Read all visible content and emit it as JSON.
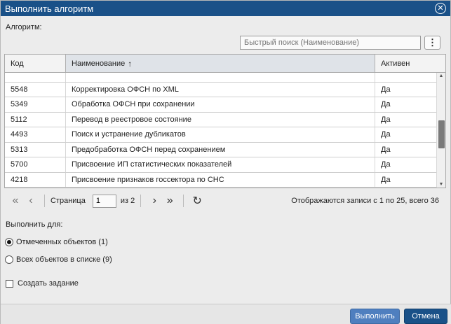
{
  "window": {
    "title": "Выполнить алгоритм"
  },
  "algorithm": {
    "label": "Алгоритм:",
    "search_placeholder": "Быстрый поиск (Наименование)",
    "menu_glyph": "⋮"
  },
  "grid": {
    "columns": {
      "code": "Код",
      "name": "Наименование",
      "active": "Активен"
    },
    "sort_arrow": "↑",
    "rows": [
      {
        "code": "",
        "name": "",
        "active": ""
      },
      {
        "code": "5548",
        "name": "Корректировка ОФСН по XML",
        "active": "Да"
      },
      {
        "code": "5349",
        "name": "Обработка ОФСН при сохранении",
        "active": "Да"
      },
      {
        "code": "5112",
        "name": "Перевод в реестровое состояние",
        "active": "Да"
      },
      {
        "code": "4493",
        "name": "Поиск и устранение дубликатов",
        "active": "Да"
      },
      {
        "code": "5313",
        "name": "Предобработка ОФСН перед сохранением",
        "active": "Да"
      },
      {
        "code": "5700",
        "name": "Присвоение ИП статистических показателей",
        "active": "Да"
      },
      {
        "code": "4218",
        "name": "Присвоение признаков госсектора по СНС",
        "active": "Да"
      },
      {
        "code": "",
        "name": "",
        "active": ""
      }
    ]
  },
  "pager": {
    "page_label": "Страница",
    "page_value": "1",
    "of_label": "из 2",
    "info": "Отображаются записи с 1 по 25, всего 36"
  },
  "execute_for": {
    "label": "Выполнить для:",
    "options": [
      {
        "label": "Отмеченных объектов (1)",
        "checked": true
      },
      {
        "label": "Всех объектов в списке (9)",
        "checked": false
      }
    ]
  },
  "create_task": {
    "label": "Создать задание",
    "checked": false
  },
  "buttons": {
    "execute": "Выполнить",
    "cancel": "Отмена"
  },
  "colors": {
    "titlebar": "#1a5188",
    "execute_button": "#4f7fbf",
    "cancel_button": "#1a5188"
  }
}
